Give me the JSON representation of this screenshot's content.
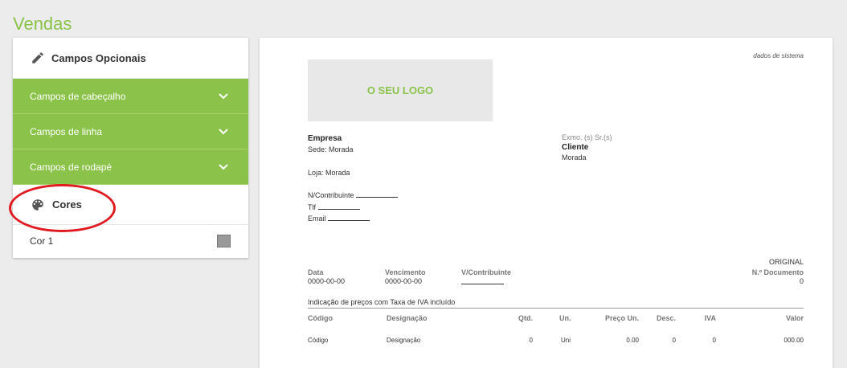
{
  "page_title": "Vendas",
  "left_panel": {
    "header_label": "Campos Opcionais",
    "sections": [
      {
        "label": "Campos de cabeçalho"
      },
      {
        "label": "Campos de linha"
      },
      {
        "label": "Campos de rodapé"
      }
    ],
    "cores_label": "Cores",
    "cor1_label": "Cor 1",
    "cor1_color": "#999999"
  },
  "document": {
    "dados_sistema": "dados de sistema",
    "logo_text": "O SEU LOGO",
    "empresa": "Empresa",
    "sede": "Sede: Morada",
    "loja": "Loja: Morada",
    "contribuinte_label": "N/Contribuinte",
    "tlf_label": "Tlf",
    "email_label": "Email",
    "exmo": "Exmo. (s) Sr.(s)",
    "cliente": "Cliente",
    "cliente_morada": "Morada",
    "original": "ORIGINAL",
    "data_label": "Data",
    "data_value": "0000-00-00",
    "vencimento_label": "Vencimento",
    "vencimento_value": "0000-00-00",
    "v_contribuinte_label": "V/Contribuinte",
    "num_doc_label": "N.º Documento",
    "num_doc_value": "0",
    "iva_note": "Indicação de preços com Taxa de IVA incluído",
    "table": {
      "headers": {
        "codigo": "Código",
        "designacao": "Designação",
        "qtd": "Qtd.",
        "un": "Un.",
        "preco": "Preço Un.",
        "desc": "Desc.",
        "iva": "IVA",
        "valor": "Valor"
      },
      "row": {
        "codigo": "Código",
        "designacao": "Designação",
        "qtd": "0",
        "un": "Uni",
        "preco": "0.00",
        "desc": "0",
        "iva": "0",
        "valor": "000.00"
      }
    }
  },
  "colors": {
    "accent": "#8bc34a",
    "highlight_ellipse": "#e11b22"
  }
}
